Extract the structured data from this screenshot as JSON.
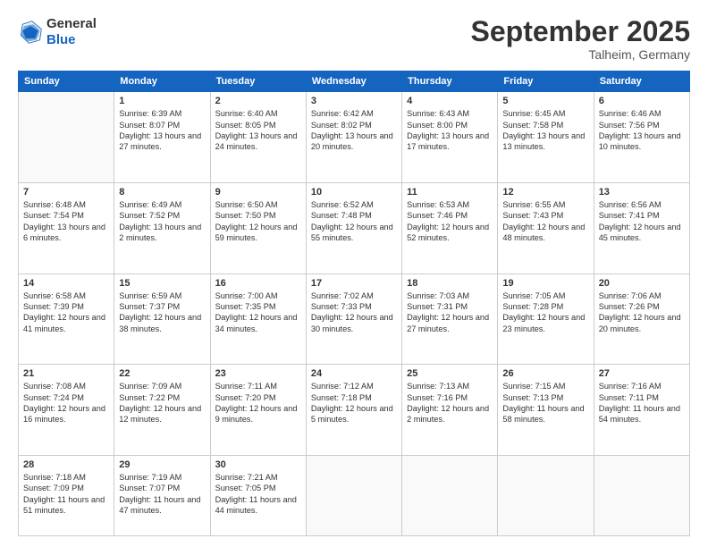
{
  "logo": {
    "general": "General",
    "blue": "Blue"
  },
  "header": {
    "month": "September 2025",
    "location": "Talheim, Germany"
  },
  "weekdays": [
    "Sunday",
    "Monday",
    "Tuesday",
    "Wednesday",
    "Thursday",
    "Friday",
    "Saturday"
  ],
  "weeks": [
    [
      {
        "day": "",
        "sunrise": "",
        "sunset": "",
        "daylight": ""
      },
      {
        "day": "1",
        "sunrise": "Sunrise: 6:39 AM",
        "sunset": "Sunset: 8:07 PM",
        "daylight": "Daylight: 13 hours and 27 minutes."
      },
      {
        "day": "2",
        "sunrise": "Sunrise: 6:40 AM",
        "sunset": "Sunset: 8:05 PM",
        "daylight": "Daylight: 13 hours and 24 minutes."
      },
      {
        "day": "3",
        "sunrise": "Sunrise: 6:42 AM",
        "sunset": "Sunset: 8:02 PM",
        "daylight": "Daylight: 13 hours and 20 minutes."
      },
      {
        "day": "4",
        "sunrise": "Sunrise: 6:43 AM",
        "sunset": "Sunset: 8:00 PM",
        "daylight": "Daylight: 13 hours and 17 minutes."
      },
      {
        "day": "5",
        "sunrise": "Sunrise: 6:45 AM",
        "sunset": "Sunset: 7:58 PM",
        "daylight": "Daylight: 13 hours and 13 minutes."
      },
      {
        "day": "6",
        "sunrise": "Sunrise: 6:46 AM",
        "sunset": "Sunset: 7:56 PM",
        "daylight": "Daylight: 13 hours and 10 minutes."
      }
    ],
    [
      {
        "day": "7",
        "sunrise": "Sunrise: 6:48 AM",
        "sunset": "Sunset: 7:54 PM",
        "daylight": "Daylight: 13 hours and 6 minutes."
      },
      {
        "day": "8",
        "sunrise": "Sunrise: 6:49 AM",
        "sunset": "Sunset: 7:52 PM",
        "daylight": "Daylight: 13 hours and 2 minutes."
      },
      {
        "day": "9",
        "sunrise": "Sunrise: 6:50 AM",
        "sunset": "Sunset: 7:50 PM",
        "daylight": "Daylight: 12 hours and 59 minutes."
      },
      {
        "day": "10",
        "sunrise": "Sunrise: 6:52 AM",
        "sunset": "Sunset: 7:48 PM",
        "daylight": "Daylight: 12 hours and 55 minutes."
      },
      {
        "day": "11",
        "sunrise": "Sunrise: 6:53 AM",
        "sunset": "Sunset: 7:46 PM",
        "daylight": "Daylight: 12 hours and 52 minutes."
      },
      {
        "day": "12",
        "sunrise": "Sunrise: 6:55 AM",
        "sunset": "Sunset: 7:43 PM",
        "daylight": "Daylight: 12 hours and 48 minutes."
      },
      {
        "day": "13",
        "sunrise": "Sunrise: 6:56 AM",
        "sunset": "Sunset: 7:41 PM",
        "daylight": "Daylight: 12 hours and 45 minutes."
      }
    ],
    [
      {
        "day": "14",
        "sunrise": "Sunrise: 6:58 AM",
        "sunset": "Sunset: 7:39 PM",
        "daylight": "Daylight: 12 hours and 41 minutes."
      },
      {
        "day": "15",
        "sunrise": "Sunrise: 6:59 AM",
        "sunset": "Sunset: 7:37 PM",
        "daylight": "Daylight: 12 hours and 38 minutes."
      },
      {
        "day": "16",
        "sunrise": "Sunrise: 7:00 AM",
        "sunset": "Sunset: 7:35 PM",
        "daylight": "Daylight: 12 hours and 34 minutes."
      },
      {
        "day": "17",
        "sunrise": "Sunrise: 7:02 AM",
        "sunset": "Sunset: 7:33 PM",
        "daylight": "Daylight: 12 hours and 30 minutes."
      },
      {
        "day": "18",
        "sunrise": "Sunrise: 7:03 AM",
        "sunset": "Sunset: 7:31 PM",
        "daylight": "Daylight: 12 hours and 27 minutes."
      },
      {
        "day": "19",
        "sunrise": "Sunrise: 7:05 AM",
        "sunset": "Sunset: 7:28 PM",
        "daylight": "Daylight: 12 hours and 23 minutes."
      },
      {
        "day": "20",
        "sunrise": "Sunrise: 7:06 AM",
        "sunset": "Sunset: 7:26 PM",
        "daylight": "Daylight: 12 hours and 20 minutes."
      }
    ],
    [
      {
        "day": "21",
        "sunrise": "Sunrise: 7:08 AM",
        "sunset": "Sunset: 7:24 PM",
        "daylight": "Daylight: 12 hours and 16 minutes."
      },
      {
        "day": "22",
        "sunrise": "Sunrise: 7:09 AM",
        "sunset": "Sunset: 7:22 PM",
        "daylight": "Daylight: 12 hours and 12 minutes."
      },
      {
        "day": "23",
        "sunrise": "Sunrise: 7:11 AM",
        "sunset": "Sunset: 7:20 PM",
        "daylight": "Daylight: 12 hours and 9 minutes."
      },
      {
        "day": "24",
        "sunrise": "Sunrise: 7:12 AM",
        "sunset": "Sunset: 7:18 PM",
        "daylight": "Daylight: 12 hours and 5 minutes."
      },
      {
        "day": "25",
        "sunrise": "Sunrise: 7:13 AM",
        "sunset": "Sunset: 7:16 PM",
        "daylight": "Daylight: 12 hours and 2 minutes."
      },
      {
        "day": "26",
        "sunrise": "Sunrise: 7:15 AM",
        "sunset": "Sunset: 7:13 PM",
        "daylight": "Daylight: 11 hours and 58 minutes."
      },
      {
        "day": "27",
        "sunrise": "Sunrise: 7:16 AM",
        "sunset": "Sunset: 7:11 PM",
        "daylight": "Daylight: 11 hours and 54 minutes."
      }
    ],
    [
      {
        "day": "28",
        "sunrise": "Sunrise: 7:18 AM",
        "sunset": "Sunset: 7:09 PM",
        "daylight": "Daylight: 11 hours and 51 minutes."
      },
      {
        "day": "29",
        "sunrise": "Sunrise: 7:19 AM",
        "sunset": "Sunset: 7:07 PM",
        "daylight": "Daylight: 11 hours and 47 minutes."
      },
      {
        "day": "30",
        "sunrise": "Sunrise: 7:21 AM",
        "sunset": "Sunset: 7:05 PM",
        "daylight": "Daylight: 11 hours and 44 minutes."
      },
      {
        "day": "",
        "sunrise": "",
        "sunset": "",
        "daylight": ""
      },
      {
        "day": "",
        "sunrise": "",
        "sunset": "",
        "daylight": ""
      },
      {
        "day": "",
        "sunrise": "",
        "sunset": "",
        "daylight": ""
      },
      {
        "day": "",
        "sunrise": "",
        "sunset": "",
        "daylight": ""
      }
    ]
  ]
}
